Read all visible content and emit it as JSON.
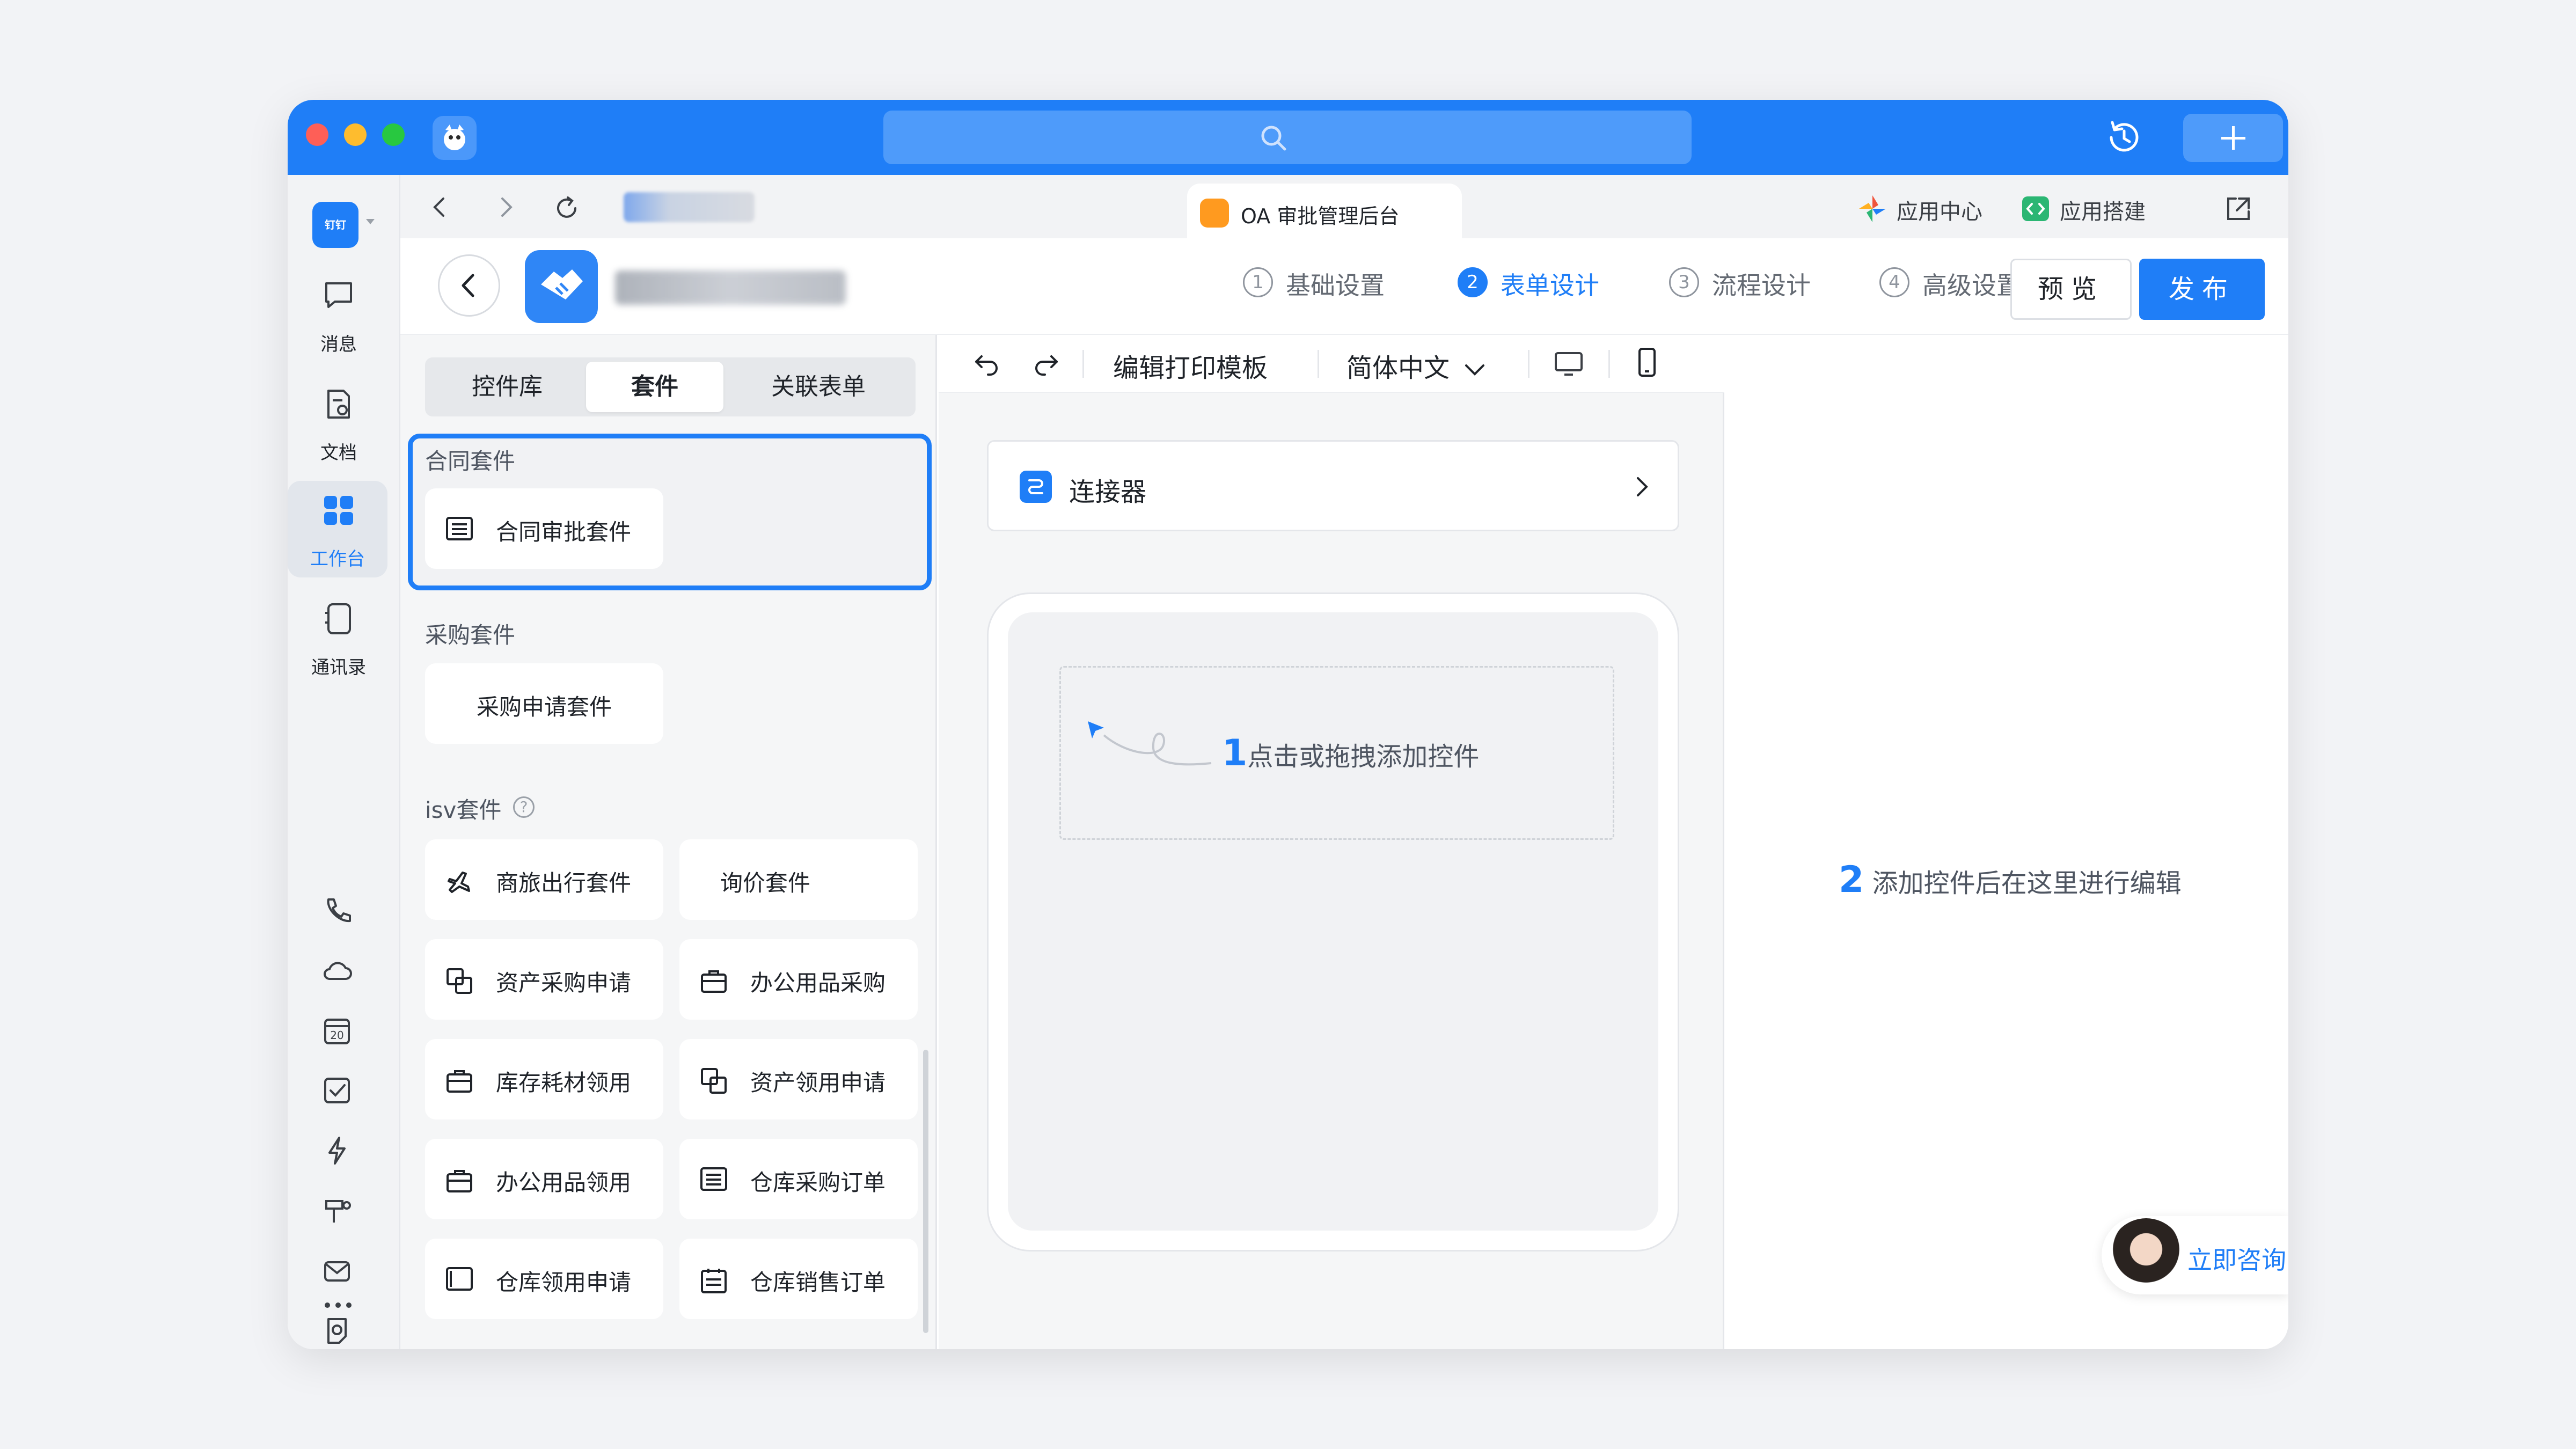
{
  "titlebar": {
    "search_icon": "search-icon",
    "history_icon": "history-icon",
    "plus_icon": "plus-icon"
  },
  "rail": {
    "brand_icon": "dingtalk-logo",
    "items": [
      {
        "label": "消息",
        "icon": "message-icon"
      },
      {
        "label": "文档",
        "icon": "document-icon"
      },
      {
        "label": "工作台",
        "icon": "workbench-icon",
        "active": true
      },
      {
        "label": "通讯录",
        "icon": "contacts-icon"
      }
    ],
    "tools": [
      "phone-icon",
      "cloud-icon",
      "calendar-icon",
      "todo-icon",
      "lightning-icon",
      "mini-app-icon",
      "mail-icon",
      "notes-icon",
      "more-icon"
    ],
    "calendar_day": "20"
  },
  "tabbar": {
    "tab_label": "OA 审批管理后台",
    "app_center": "应用中心",
    "app_builder": "应用搭建"
  },
  "header": {
    "steps": [
      {
        "num": "1",
        "label": "基础设置"
      },
      {
        "num": "2",
        "label": "表单设计",
        "active": true
      },
      {
        "num": "3",
        "label": "流程设计"
      },
      {
        "num": "4",
        "label": "高级设置"
      }
    ],
    "preview": "预览",
    "publish": "发布"
  },
  "left_panel": {
    "segments": [
      "控件库",
      "套件",
      "关联表单"
    ],
    "active_segment": "套件",
    "sections": [
      {
        "title": "合同套件",
        "kits": [
          {
            "label": "合同审批套件",
            "icon": "list-icon"
          }
        ]
      },
      {
        "title": "采购套件",
        "kits": [
          {
            "label": "采购申请套件",
            "icon": ""
          }
        ]
      },
      {
        "title": "isv套件",
        "kits": [
          {
            "label": "商旅出行套件",
            "icon": "airplane-icon"
          },
          {
            "label": "询价套件",
            "icon": ""
          },
          {
            "label": "资产采购申请",
            "icon": "copy-icon"
          },
          {
            "label": "办公用品采购",
            "icon": "briefcase-icon"
          },
          {
            "label": "库存耗材领用",
            "icon": "briefcase-icon"
          },
          {
            "label": "资产领用申请",
            "icon": "copy-icon"
          },
          {
            "label": "办公用品领用",
            "icon": "briefcase-icon"
          },
          {
            "label": "仓库采购订单",
            "icon": "list-icon"
          },
          {
            "label": "仓库领用申请",
            "icon": "frame-icon"
          },
          {
            "label": "仓库销售订单",
            "icon": "calendar-list-icon"
          }
        ]
      }
    ],
    "help_glyph": "?"
  },
  "canvas": {
    "toolbar": {
      "undo_icon": "undo-icon",
      "redo_icon": "redo-icon",
      "print_template": "编辑打印模板",
      "language": "简体中文",
      "desktop_icon": "desktop-icon",
      "mobile_icon": "mobile-icon"
    },
    "connector": "连接器",
    "hint_num": "1",
    "hint": "点击或拖拽添加控件"
  },
  "right_panel": {
    "hint_num": "2",
    "hint": "添加控件后在这里进行编辑",
    "consult": "立即咨询"
  },
  "colors": {
    "accent": "#1f7ef7",
    "titlebar": "#1f7ef7",
    "tab_icon": "#ff9a1f"
  }
}
